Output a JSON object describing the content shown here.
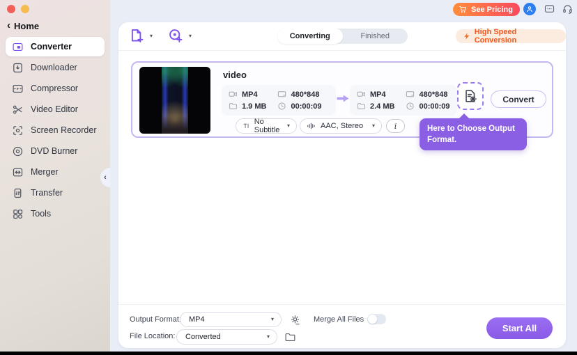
{
  "window": {
    "home_label": "Home"
  },
  "glyphs": {
    "chevron_down": "▾",
    "back_chevron": "‹",
    "collapse_chevron": "‹",
    "info_symbol": "i"
  },
  "topbar": {
    "see_pricing_label": "See Pricing"
  },
  "sidebar": {
    "items": [
      {
        "label": "Converter",
        "active": true
      },
      {
        "label": "Downloader",
        "active": false
      },
      {
        "label": "Compressor",
        "active": false
      },
      {
        "label": "Video Editor",
        "active": false
      },
      {
        "label": "Screen Recorder",
        "active": false
      },
      {
        "label": "DVD Burner",
        "active": false
      },
      {
        "label": "Merger",
        "active": false
      },
      {
        "label": "Transfer",
        "active": false
      },
      {
        "label": "Tools",
        "active": false
      }
    ]
  },
  "toolbar": {
    "tabs": [
      {
        "label": "Converting",
        "active": true
      },
      {
        "label": "Finished",
        "active": false
      }
    ],
    "high_speed_label": "High Speed Conversion"
  },
  "card": {
    "title": "video",
    "source": {
      "format": "MP4",
      "resolution": "480*848",
      "size": "1.9 MB",
      "duration": "00:00:09"
    },
    "output": {
      "format": "MP4",
      "resolution": "480*848",
      "size": "2.4 MB",
      "duration": "00:00:09"
    },
    "subtitle_value": "No Subtitle",
    "audio_value": "AAC, Stereo",
    "convert_label": "Convert"
  },
  "tooltip": {
    "text": "Here to Choose Output Format."
  },
  "footer": {
    "output_format_label": "Output Format:",
    "output_format_value": "MP4",
    "merge_label": "Merge All Files",
    "merge_enabled": false,
    "file_location_label": "File Location:",
    "file_location_value": "Converted",
    "start_all_label": "Start All"
  },
  "colors": {
    "accent_purple": "#7c4ff0",
    "tooltip_purple": "#8a5fe3",
    "start_button_purple": "#9065ea",
    "high_speed_orange": "#f4581f",
    "pricing_gradient_start": "#ff8e3c",
    "pricing_gradient_end": "#f9495f",
    "user_badge_blue": "#2d7ff0",
    "card_border_purple": "#c5b7ef"
  }
}
